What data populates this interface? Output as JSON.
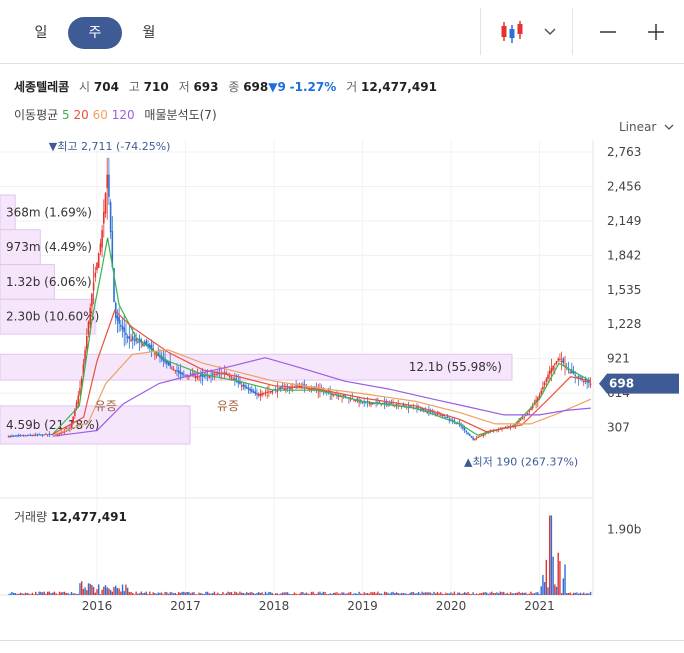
{
  "periods": [
    {
      "label": "일",
      "active": false
    },
    {
      "label": "주",
      "active": true
    },
    {
      "label": "월",
      "active": false
    }
  ],
  "toolbar": {
    "chart_type_icon": "candlestick-icon",
    "dropdown_icon": "chevron-down-icon",
    "zoom_out": "—",
    "zoom_in": "+"
  },
  "stock": {
    "name": "세종텔레콤",
    "open_label": "시",
    "open": "704",
    "high_label": "고",
    "high": "710",
    "low_label": "저",
    "low": "693",
    "close_label": "종",
    "close": "698",
    "change": "▼9",
    "change_pct": "-1.27%",
    "volume_label": "거",
    "volume": "12,477,491"
  },
  "ma": {
    "label": "이동평균",
    "p5": "5",
    "p20": "20",
    "p60": "60",
    "p120": "120",
    "vp_label": "매물분석도(7)"
  },
  "scale_label": "Linear",
  "colors": {
    "up": "#e2342e",
    "down": "#2c6fd6",
    "ma5": "#3cb44b",
    "ma20": "#e8523a",
    "ma60": "#f0a060",
    "ma120": "#9b5de5",
    "vp_fill": "#f6e6fb",
    "vp_stroke": "#e2c5ef",
    "accent": "#3f5b95"
  },
  "chart_data": {
    "type": "candlestick",
    "x_ticks": [
      "2016",
      "2017",
      "2018",
      "2019",
      "2020",
      "2021"
    ],
    "y_ticks": [
      2763,
      2456,
      2149,
      1842,
      1535,
      1228,
      921,
      614,
      307
    ],
    "ylim": [
      0,
      2763
    ],
    "current_price": 698,
    "current_price_label": "698",
    "high_annotation": "▼최고 2,711 (-74.25%)",
    "high_value": 2711,
    "high_date": "2016.12",
    "low_annotation": "▲최저 190 (267.37%)",
    "low_value": 190,
    "low_date": "2020.25",
    "events": [
      {
        "label": "유증",
        "x": 2016.1,
        "y": 500
      },
      {
        "label": "유증",
        "x": 2017.48,
        "y": 500
      }
    ],
    "volume_profile": [
      {
        "label": "368m (1.69%)",
        "low": 2070,
        "high": 2380,
        "pct": 1.69
      },
      {
        "label": "973m (4.49%)",
        "low": 1760,
        "high": 2070,
        "pct": 4.49
      },
      {
        "label": "1.32b (6.06%)",
        "low": 1450,
        "high": 1760,
        "pct": 6.06
      },
      {
        "label": "2.30b (10.60%)",
        "low": 1140,
        "high": 1450,
        "pct": 10.6
      },
      {
        "label": "12.1b (55.98%)",
        "low": 730,
        "high": 960,
        "pct": 55.98
      },
      {
        "label": "4.59b (21.18%)",
        "low": 160,
        "high": 500,
        "pct": 21.18
      }
    ],
    "price_path": [
      [
        2015.0,
        230
      ],
      [
        2015.3,
        240
      ],
      [
        2015.55,
        250
      ],
      [
        2015.7,
        300
      ],
      [
        2015.82,
        700
      ],
      [
        2015.95,
        1550
      ],
      [
        2016.05,
        2000
      ],
      [
        2016.12,
        2600
      ],
      [
        2016.2,
        1300
      ],
      [
        2016.35,
        1100
      ],
      [
        2016.55,
        1050
      ],
      [
        2016.75,
        900
      ],
      [
        2016.95,
        780
      ],
      [
        2017.2,
        760
      ],
      [
        2017.45,
        800
      ],
      [
        2017.6,
        700
      ],
      [
        2017.8,
        600
      ],
      [
        2018.0,
        640
      ],
      [
        2018.3,
        680
      ],
      [
        2018.5,
        640
      ],
      [
        2018.8,
        580
      ],
      [
        2019.0,
        530
      ],
      [
        2019.3,
        520
      ],
      [
        2019.6,
        480
      ],
      [
        2019.9,
        420
      ],
      [
        2020.1,
        330
      ],
      [
        2020.25,
        200
      ],
      [
        2020.45,
        280
      ],
      [
        2020.7,
        320
      ],
      [
        2020.85,
        420
      ],
      [
        2021.0,
        600
      ],
      [
        2021.12,
        820
      ],
      [
        2021.22,
        930
      ],
      [
        2021.35,
        800
      ],
      [
        2021.5,
        720
      ],
      [
        2021.58,
        698
      ]
    ],
    "ma_series": [
      {
        "name": "5",
        "color": "#3cb44b",
        "points": [
          [
            2015.5,
            250
          ],
          [
            2015.8,
            500
          ],
          [
            2015.95,
            1300
          ],
          [
            2016.05,
            1700
          ],
          [
            2016.12,
            2000
          ],
          [
            2016.25,
            1400
          ],
          [
            2016.45,
            1100
          ],
          [
            2016.8,
            900
          ],
          [
            2017.2,
            780
          ],
          [
            2017.6,
            720
          ],
          [
            2018.0,
            640
          ],
          [
            2018.5,
            640
          ],
          [
            2019.0,
            540
          ],
          [
            2019.6,
            480
          ],
          [
            2020.1,
            340
          ],
          [
            2020.3,
            240
          ],
          [
            2020.7,
            320
          ],
          [
            2021.0,
            560
          ],
          [
            2021.22,
            880
          ],
          [
            2021.58,
            720
          ]
        ]
      },
      {
        "name": "20",
        "color": "#e8523a",
        "points": [
          [
            2015.5,
            250
          ],
          [
            2015.85,
            400
          ],
          [
            2016.0,
            900
          ],
          [
            2016.2,
            1350
          ],
          [
            2016.4,
            1200
          ],
          [
            2016.8,
            980
          ],
          [
            2017.2,
            820
          ],
          [
            2017.6,
            760
          ],
          [
            2018.0,
            680
          ],
          [
            2018.5,
            650
          ],
          [
            2019.0,
            570
          ],
          [
            2019.6,
            500
          ],
          [
            2020.1,
            380
          ],
          [
            2020.4,
            270
          ],
          [
            2020.8,
            330
          ],
          [
            2021.1,
            560
          ],
          [
            2021.35,
            760
          ],
          [
            2021.58,
            720
          ]
        ]
      },
      {
        "name": "60",
        "color": "#f0a060",
        "points": [
          [
            2015.5,
            240
          ],
          [
            2015.9,
            350
          ],
          [
            2016.1,
            700
          ],
          [
            2016.4,
            960
          ],
          [
            2016.8,
            1000
          ],
          [
            2017.2,
            880
          ],
          [
            2017.6,
            800
          ],
          [
            2018.0,
            720
          ],
          [
            2018.5,
            660
          ],
          [
            2019.0,
            610
          ],
          [
            2019.6,
            540
          ],
          [
            2020.1,
            440
          ],
          [
            2020.5,
            340
          ],
          [
            2020.9,
            340
          ],
          [
            2021.2,
            430
          ],
          [
            2021.58,
            560
          ]
        ]
      },
      {
        "name": "120",
        "color": "#9b5de5",
        "points": [
          [
            2015.5,
            230
          ],
          [
            2016.0,
            280
          ],
          [
            2016.3,
            520
          ],
          [
            2016.7,
            700
          ],
          [
            2017.1,
            780
          ],
          [
            2017.5,
            850
          ],
          [
            2017.9,
            930
          ],
          [
            2018.3,
            840
          ],
          [
            2018.8,
            720
          ],
          [
            2019.3,
            650
          ],
          [
            2019.8,
            560
          ],
          [
            2020.2,
            490
          ],
          [
            2020.6,
            420
          ],
          [
            2021.0,
            420
          ],
          [
            2021.3,
            460
          ],
          [
            2021.58,
            480
          ]
        ]
      }
    ],
    "volume_label": "거래량",
    "volume_value": "12,477,491",
    "volume_axis_tick": "1.90b",
    "volume_max": 2400
  }
}
